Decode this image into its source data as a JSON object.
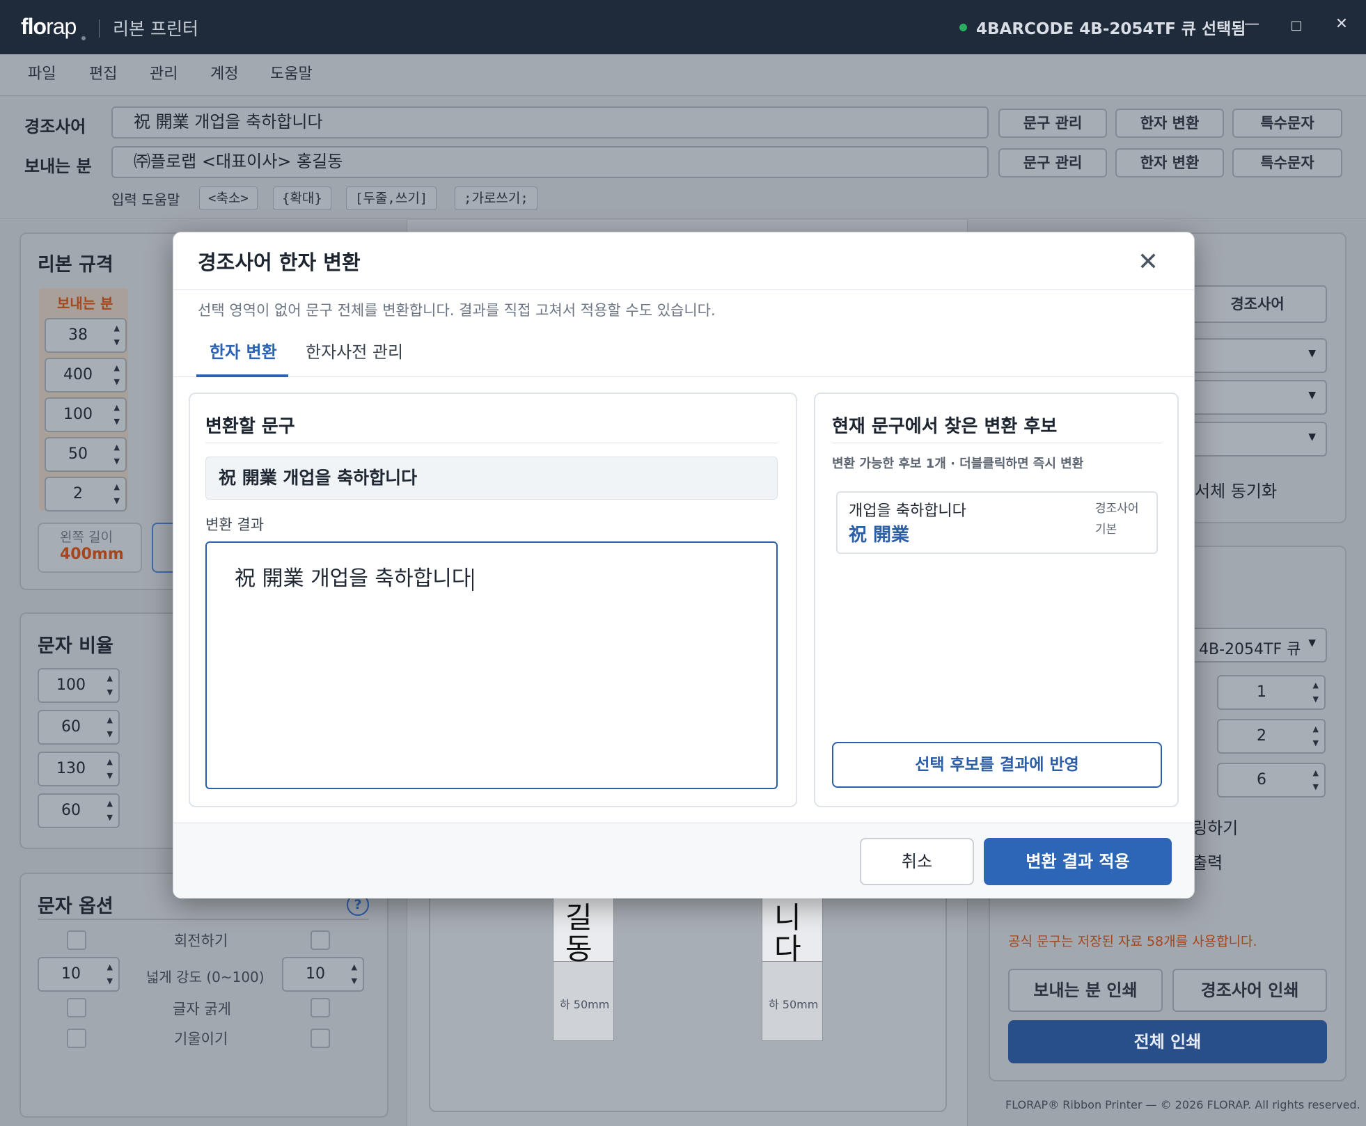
{
  "app": {
    "brand_bold": "flo",
    "brand_light": "rap",
    "title": "리본 프린터",
    "printer_status": "4BARCODE 4B-2054TF 큐 선택됨",
    "minimize": "—",
    "maximize": "□",
    "close": "✕"
  },
  "menu": [
    "파일",
    "편집",
    "관리",
    "계정",
    "도움말"
  ],
  "inputs": {
    "congrats_label": "경조사어",
    "congrats_value": "祝 開業 개업을 축하합니다",
    "sender_label": "보내는 분",
    "sender_value": "㈜플로랩 <대표이사> 홍길동",
    "btn_phrase": "문구 관리",
    "btn_hanja": "한자 변환",
    "btn_special": "특수문자",
    "help_label": "입력 도움말",
    "help_chips": [
      "<축소>",
      "{확대}",
      "[두줄,쓰기]",
      ";가로쓰기;"
    ]
  },
  "left": {
    "spec_title": "리본 규격",
    "sender_col": "보내는 분",
    "spec_values": [
      "38",
      "400",
      "100",
      "50",
      "2"
    ],
    "left_len_label": "왼쪽 길이",
    "left_len_value": "400mm",
    "ratio_title": "문자 비율",
    "ratio_values": [
      "100",
      "60",
      "130",
      "60"
    ],
    "options_title": "문자 옵션",
    "help_icon": "?",
    "rotate": "회전하기",
    "spread": "넓게 강도 (0~100)",
    "spread_left": "10",
    "spread_right": "10",
    "bold": "글자 굵게",
    "italic": "기울이기"
  },
  "preview": {
    "left_chars": [
      "길",
      "동"
    ],
    "right_chars": [
      "니",
      "다"
    ],
    "bottom_left": "하 50mm",
    "bottom_right": "하 50mm"
  },
  "right": {
    "congrats_btn": "경조사어",
    "sync_label": "서체 동기화",
    "printer_select": "4B-2054TF 큐",
    "spin_values": [
      "1",
      "2",
      "6"
    ],
    "opt1": "링하기",
    "opt2": "출력",
    "notice": "공식 문구는 저장된 자료 58개를 사용합니다.",
    "print_sender": "보내는 분 인쇄",
    "print_congrats": "경조사어 인쇄",
    "print_all": "전체 인쇄",
    "copyright": "FLORAP® Ribbon Printer — © 2026 FLORAP. All rights reserved."
  },
  "modal": {
    "title": "경조사어 한자 변환",
    "close": "✕",
    "hint": "선택 영역이 없어 문구 전체를 변환합니다. 결과를 직접 고쳐서 적용할 수도 있습니다.",
    "tabs": [
      "한자 변환",
      "한자사전 관리"
    ],
    "source_title": "변환할 문구",
    "source_value": "祝 開業 개업을 축하합니다",
    "result_label": "변환 결과",
    "result_value": "祝 開業 개업을 축하합니다",
    "cand_title": "현재 문구에서 찾은 변환 후보",
    "cand_subtitle": "변환 가능한 후보 1개 · 더블클릭하면 즉시 변환",
    "cand_text": "개업을 축하합니다",
    "cand_hanja": "祝 開業",
    "cand_cat": "경조사어",
    "cand_type": "기본",
    "apply_selected": "선택 후보를 결과에 반영",
    "cancel": "취소",
    "apply": "변환 결과 적용"
  },
  "colors": {
    "titlebar": "#1f2a3a",
    "accent": "#2d66b6",
    "status_green": "#27ae60",
    "warning_orange": "#c0511c"
  }
}
